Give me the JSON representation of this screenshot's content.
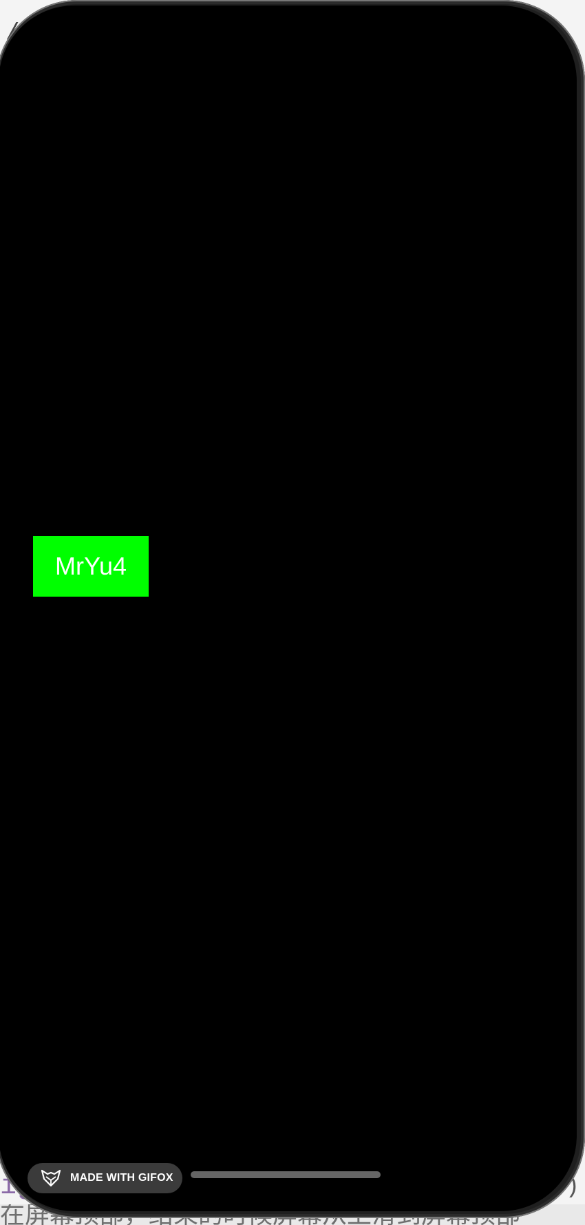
{
  "screen": {
    "button_label": "MrYu4"
  },
  "gifox": {
    "label": "MADE WITH GIFOX",
    "icon": "fox-icon"
  },
  "background_text": {
    "top_fragment": "/",
    "left_fragment": "ig",
    "right_fragment": ")",
    "bottom_fragment": "在屏幕顶部，结束的时候屏幕从上滑到屏幕顶部"
  },
  "colors": {
    "screen_background": "#000000",
    "button_background": "#00ff00",
    "button_text": "#ffffff",
    "badge_background": "#3b3b3b"
  }
}
